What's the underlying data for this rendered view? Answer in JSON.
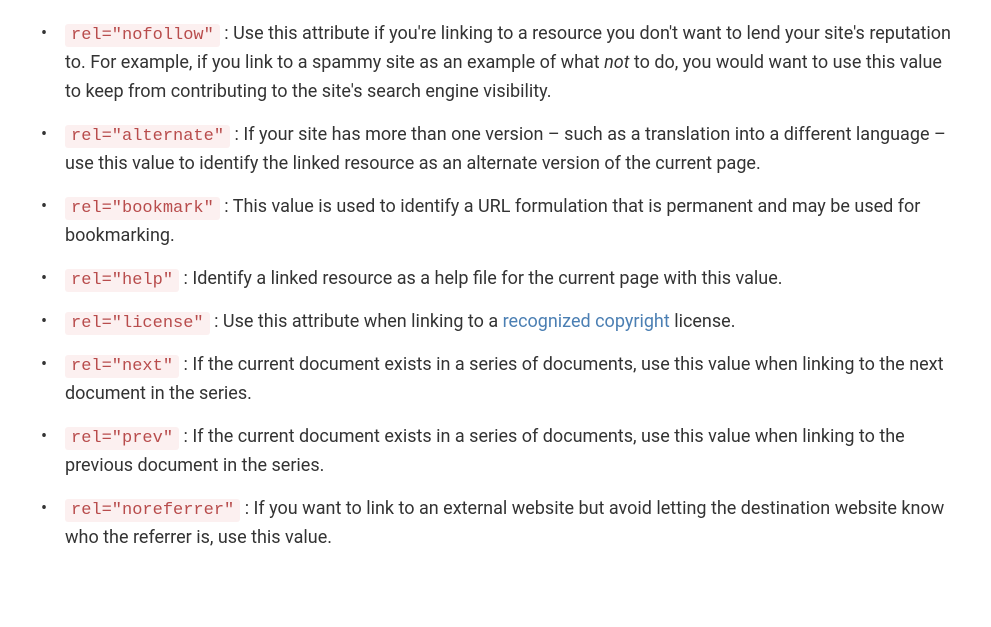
{
  "items": [
    {
      "code": "rel=\"nofollow\"",
      "text_pre": " : Use this attribute if you're linking to a resource you don't want to lend your site's reputation to. For example, if you link to a spammy site as an example of what ",
      "em": "not",
      "text_post": " to do, you would want to use this value to keep from contributing to the site's search engine visibility."
    },
    {
      "code": "rel=\"alternate\"",
      "text_pre": " : If your site has more than one version – such as a translation into a different language – use this value to identify the linked resource as an alternate version of the current page."
    },
    {
      "code": "rel=\"bookmark\"",
      "text_pre": " : This value is used to identify a URL formulation that is permanent and may be used for bookmarking."
    },
    {
      "code": "rel=\"help\"",
      "text_pre": " : Identify a linked resource as a help file for the current page with this value."
    },
    {
      "code": "rel=\"license\"",
      "text_pre": " : Use this attribute when linking to a ",
      "link": "recognized copyright",
      "text_post": " license."
    },
    {
      "code": "rel=\"next\"",
      "text_pre": " : If the current document exists in a series of documents, use this value when linking to the next document in the series."
    },
    {
      "code": "rel=\"prev\"",
      "text_pre": " : If the current document exists in a series of documents, use this value when linking to the previous document in the series."
    },
    {
      "code": "rel=\"noreferrer\"",
      "text_pre": " : If you want to link to an external website but avoid letting the destination website know who the referrer is, use this value."
    }
  ]
}
